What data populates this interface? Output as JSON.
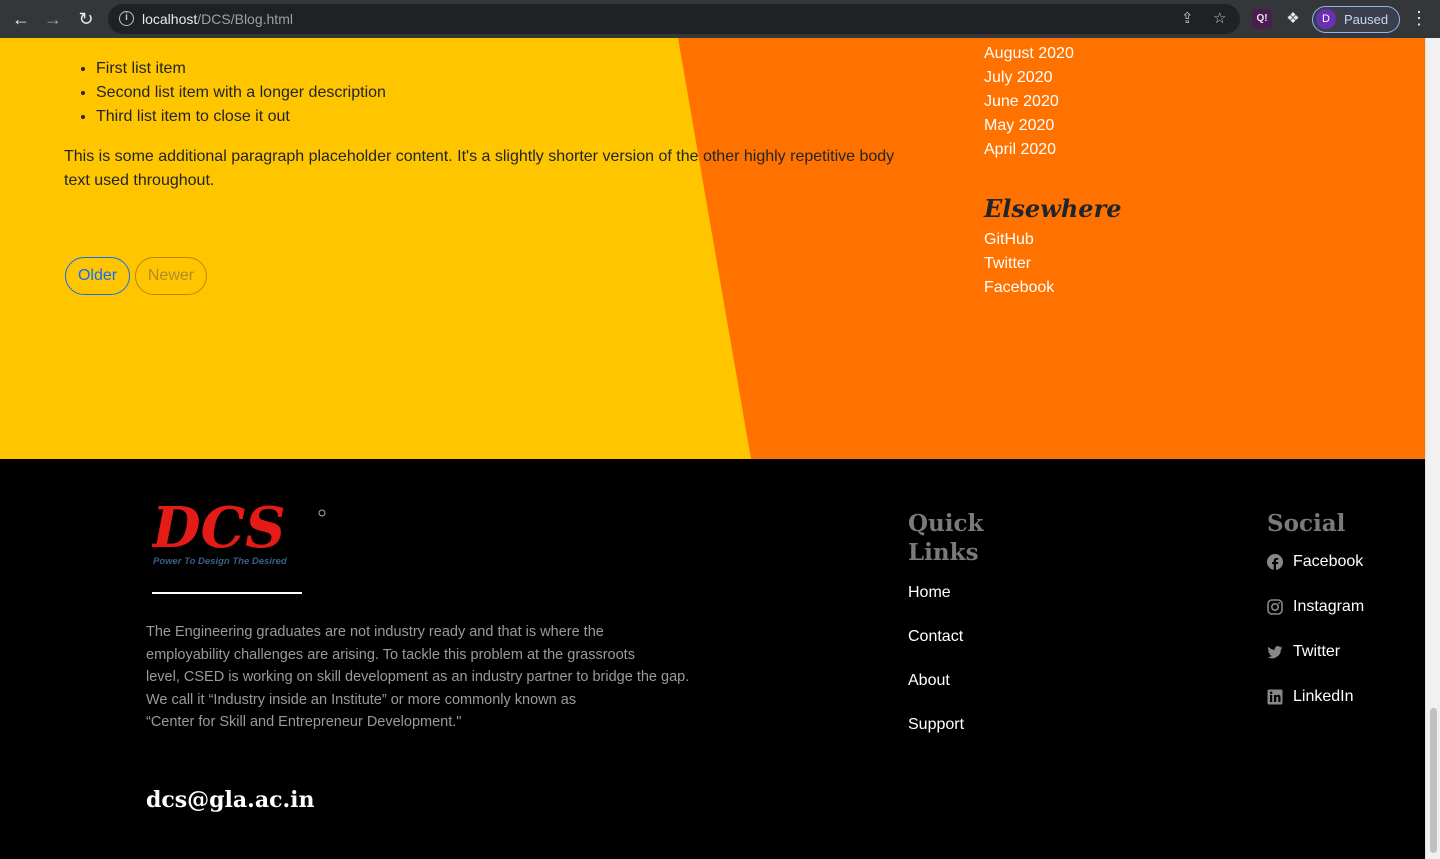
{
  "browser": {
    "url_host": "localhost",
    "url_path": "/DCS/Blog.html",
    "profile_initial": "D",
    "profile_label": "Paused",
    "ext_label": "Q!"
  },
  "post": {
    "list_items": [
      "First list item",
      "Second list item with a longer description",
      "Third list item to close it out"
    ],
    "paragraph": "This is some additional paragraph placeholder content. It's a slightly shorter version of the other highly repetitive body text used throughout."
  },
  "pager": {
    "older": "Older",
    "newer": "Newer"
  },
  "sidebar": {
    "archive": [
      "August 2020",
      "July 2020",
      "June 2020",
      "May 2020",
      "April 2020"
    ],
    "elsewhere_heading": "Elsewhere",
    "elsewhere": [
      "GitHub",
      "Twitter",
      "Facebook"
    ]
  },
  "footer": {
    "logo_text": "DCS",
    "logo_tagline": "Power To Design The Desired",
    "about_lines": [
      "The Engineering graduates are not industry ready and that is where the",
      "employability challenges are arising. To tackle this problem at the grassroots",
      "level, CSED is working on skill development as an industry partner to bridge the gap.",
      "We call it “Industry inside an Institute” or more commonly known as",
      "“Center for Skill and Entrepreneur Development.\""
    ],
    "email": "dcs@gla.ac.in",
    "quick_heading": "Quick Links",
    "quick_links": [
      "Home",
      "Contact",
      "About",
      "Support"
    ],
    "social_heading": "Social",
    "social_links": [
      {
        "label": "Facebook",
        "icon": "facebook-icon"
      },
      {
        "label": "Instagram",
        "icon": "instagram-icon"
      },
      {
        "label": "Twitter",
        "icon": "twitter-icon"
      },
      {
        "label": "LinkedIn",
        "icon": "linkedin-icon"
      }
    ]
  },
  "colors": {
    "yellow": "#ffc600",
    "orange": "#ff7200",
    "footer_bg": "#000000",
    "link_blue": "#0d6efd",
    "logo_red": "#e41b17"
  }
}
